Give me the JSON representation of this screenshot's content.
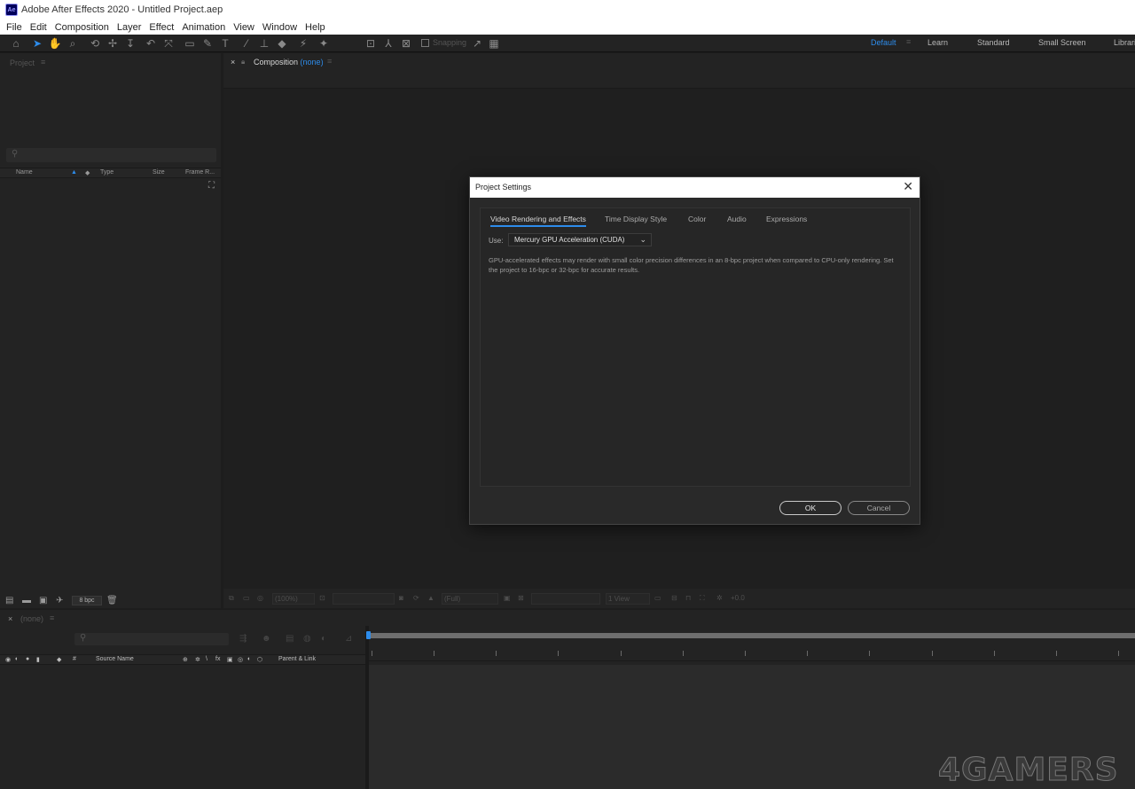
{
  "window": {
    "title": "Adobe After Effects 2020 - Untitled Project.aep",
    "logo": "Ae"
  },
  "menu": [
    "File",
    "Edit",
    "Composition",
    "Layer",
    "Effect",
    "Animation",
    "View",
    "Window",
    "Help"
  ],
  "toolbar": {
    "snapping_label": "Snapping",
    "workspaces": [
      "Default",
      "Learn",
      "Standard",
      "Small Screen",
      "Librari"
    ],
    "active_workspace": "Default"
  },
  "project_panel": {
    "tab_label": "Project",
    "columns": [
      "Name",
      "Type",
      "Size",
      "Frame R..."
    ],
    "bpc": "8 bpc"
  },
  "composition_panel": {
    "tab_label": "Composition",
    "comp_name": "(none)",
    "footer": {
      "zoom": "(100%)",
      "resolution": "(Full)",
      "view": "1 View",
      "exposure": "+0.0"
    }
  },
  "timeline": {
    "tab_label": "(none)",
    "columns": [
      "#",
      "Source Name",
      "Parent & Link"
    ]
  },
  "dialog": {
    "title": "Project Settings",
    "tabs": [
      "Video Rendering and Effects",
      "Time Display Style",
      "Color",
      "Audio",
      "Expressions"
    ],
    "active_tab": 0,
    "use_label": "Use:",
    "use_value": "Mercury GPU Acceleration (CUDA)",
    "description": "GPU-accelerated effects may render with small color precision differences in an 8-bpc project when compared to CPU-only rendering. Set the project to 16-bpc or 32-bpc for accurate results.",
    "ok_label": "OK",
    "cancel_label": "Cancel"
  },
  "watermark": "4GAMERS",
  "colors": {
    "accent": "#2d8ceb",
    "panel": "#232323",
    "background": "#1d1d1d"
  }
}
